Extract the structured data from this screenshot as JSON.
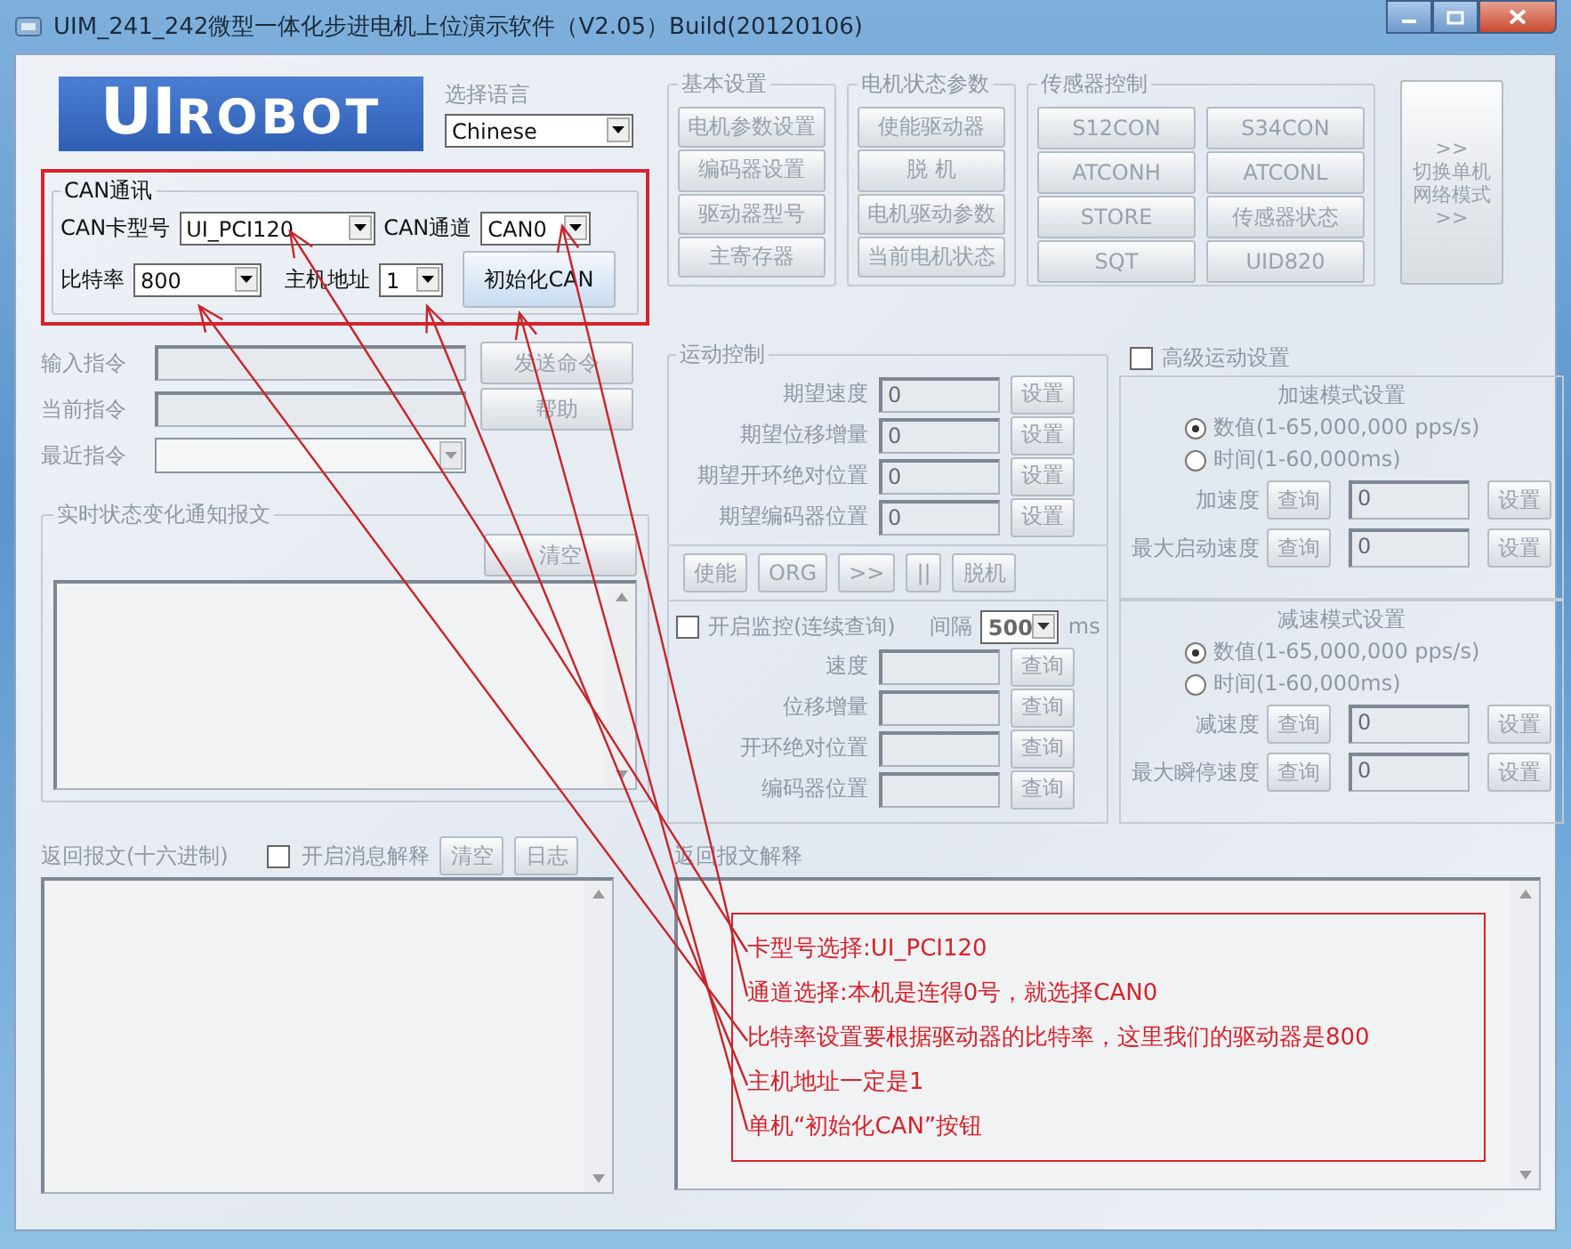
{
  "window": {
    "title": "UIM_241_242微型一体化步进电机上位演示软件（V2.05）Build(20120106)"
  },
  "logo": {
    "part_1": "UI",
    "part_2": "ROBOT"
  },
  "language": {
    "label": "选择语言",
    "value": "Chinese"
  },
  "can": {
    "title": "CAN通讯",
    "card_type": {
      "label": "CAN卡型号",
      "value": "UI_PCI120"
    },
    "channel": {
      "label": "CAN通道",
      "value": "CAN0"
    },
    "baud": {
      "label": "比特率",
      "value": "800"
    },
    "host": {
      "label": "主机地址",
      "value": "1"
    },
    "init_button": "初始化CAN"
  },
  "basic_settings": {
    "title": "基本设置",
    "buttons": [
      "电机参数设置",
      "编码器设置",
      "驱动器型号",
      "主寄存器"
    ]
  },
  "motor_status": {
    "title": "电机状态参数",
    "buttons": [
      "使能驱动器",
      "脱 机",
      "电机驱动参数",
      "当前电机状态"
    ]
  },
  "sensor_control": {
    "title": "传感器控制",
    "buttons": [
      "S12CON",
      "S34CON",
      "ATCONH",
      "ATCONL",
      "STORE",
      "传感器状态",
      "SQT",
      "UID820"
    ]
  },
  "switch_button": {
    "lines": [
      ">>",
      "切换单机",
      "网络模式",
      ">>"
    ]
  },
  "commands": [
    {
      "label": "输入指令",
      "kind": "input",
      "button": "发送命令"
    },
    {
      "label": "当前指令",
      "kind": "input",
      "button": "帮助"
    },
    {
      "label": "最近指令",
      "kind": "dropdown"
    }
  ],
  "realtime": {
    "title": "实时状态变化通知报文",
    "clear_button": "清空"
  },
  "motion": {
    "title": "运动控制",
    "rows": [
      {
        "label": "期望速度",
        "value": "0",
        "button": "设置"
      },
      {
        "label": "期望位移增量",
        "value": "0",
        "button": "设置"
      },
      {
        "label": "期望开环绝对位置",
        "value": "0",
        "button": "设置"
      },
      {
        "label": "期望编码器位置",
        "value": "0",
        "button": "设置"
      }
    ],
    "buttons": [
      "使能",
      "ORG",
      ">>",
      "||",
      "脱机"
    ]
  },
  "monitor": {
    "label": "开启监控(连续查询)",
    "checked": false,
    "interval_label": "间隔",
    "interval": "500",
    "unit": "ms",
    "rows": [
      {
        "label": "速度",
        "button": "查询"
      },
      {
        "label": "位移增量",
        "button": "查询"
      },
      {
        "label": "开环绝对位置",
        "button": "查询"
      },
      {
        "label": "编码器位置",
        "button": "查询"
      }
    ]
  },
  "advanced": {
    "label": "高级运动设置",
    "checked": false,
    "sections": [
      {
        "title": "加速模式设置",
        "options": [
          {
            "label": "数值(1-65,000,000 pps/s)",
            "selected": true
          },
          {
            "label": "时间(1-60,000ms)",
            "selected": false
          }
        ],
        "rows": [
          {
            "label": "加速度",
            "query": "查询",
            "value": "0",
            "set": "设置"
          },
          {
            "label": "最大启动速度",
            "query": "查询",
            "value": "0",
            "set": "设置"
          }
        ]
      },
      {
        "title": "减速模式设置",
        "options": [
          {
            "label": "数值(1-65,000,000 pps/s)",
            "selected": true
          },
          {
            "label": "时间(1-60,000ms)",
            "selected": false
          }
        ],
        "rows": [
          {
            "label": "减速度",
            "query": "查询",
            "value": "0",
            "set": "设置"
          },
          {
            "label": "最大瞬停速度",
            "query": "查询",
            "value": "0",
            "set": "设置"
          }
        ]
      }
    ]
  },
  "return_hex": {
    "label": "返回报文(十六进制)",
    "parse_checkbox": {
      "label": "开启消息解释",
      "checked": false
    },
    "buttons": [
      "清空",
      "日志"
    ]
  },
  "return_explain": {
    "label": "返回报文解释",
    "notes": [
      "卡型号选择:UI_PCI120",
      "通道选择:本机是连得0号，就选择CAN0",
      "比特率设置要根据驱动器的比特率，这里我们的驱动器是800",
      "主机地址一定是1",
      "单机“初始化CAN”按钮"
    ]
  }
}
